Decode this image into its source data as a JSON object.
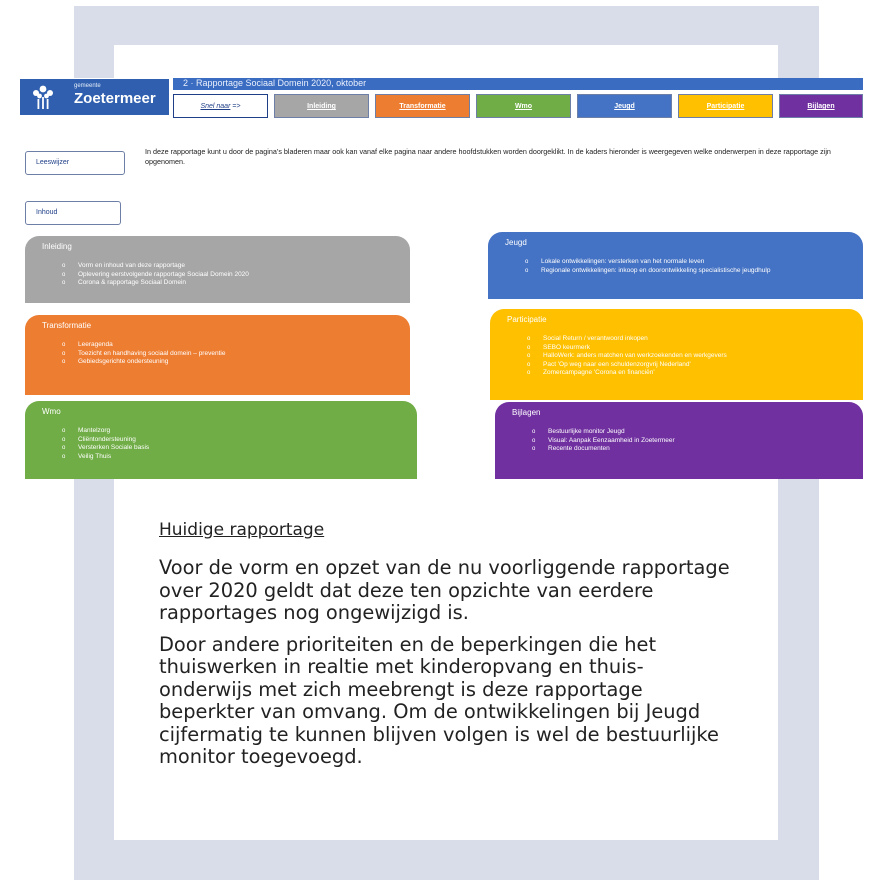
{
  "embedded_page": {
    "logo": {
      "small": "gemeente",
      "name": "Zoetermeer"
    },
    "title_bar": "2 · Rapportage Sociaal Domein 2020, oktober",
    "snel_naar": {
      "text": "Snel naar",
      "arrow": "=>"
    },
    "nav": [
      {
        "label": "Inleiding",
        "color": "#a6a6a6",
        "text_color": "#ffffff"
      },
      {
        "label": "Transformatie",
        "color": "#ed7d31",
        "text_color": "#ffffff"
      },
      {
        "label": "Wmo",
        "color": "#70ad47",
        "text_color": "#ffffff"
      },
      {
        "label": "Jeugd",
        "color": "#4472c4",
        "text_color": "#ffffff"
      },
      {
        "label": "Participatie",
        "color": "#ffc000",
        "text_color": "#ffffff"
      },
      {
        "label": "Bijlagen",
        "color": "#7030a0",
        "text_color": "#ffffff"
      }
    ],
    "leeswijzer": "Leeswijzer",
    "intro": "In deze rapportage kunt u door de pagina’s bladeren maar ook kan vanaf elke pagina naar andere hoofdstukken worden doorgeklikt. In de kaders hieronder is weergegeven welke onderwerpen in deze rapportage zijn opgenomen.",
    "inhoud": "Inhoud",
    "cards": [
      {
        "title": "Inleiding",
        "color": "#a6a6a6",
        "items": [
          "Vorm en inhoud van deze rapportage",
          "Oplevering eerstvolgende rapportage Sociaal Domein 2020",
          "Corona & rapportage Sociaal Domein"
        ]
      },
      {
        "title": "Jeugd",
        "color": "#4472c4",
        "items": [
          "Lokale ontwikkelingen: versterken van het normale leven",
          "Regionale ontwikkelingen: inkoop en doorontwikkeling specialistische jeugdhulp"
        ]
      },
      {
        "title": "Transformatie",
        "color": "#ed7d31",
        "items": [
          "Leeragenda",
          "Toezicht en handhaving sociaal domein – preventie",
          "Gebiedsgerichte ondersteuning"
        ]
      },
      {
        "title": "Participatie",
        "color": "#ffc000",
        "items": [
          "Social Return / verantwoord inkopen",
          "SEBO keurmerk",
          "HalloWerk: anders matchen van werkzoekenden en werkgevers",
          "Pact 'Op weg naar een schuldenzorgvrij Nederland'",
          "Zomercampagne 'Corona en financiën'"
        ]
      },
      {
        "title": "Wmo",
        "color": "#70ad47",
        "items": [
          "Mantelzorg",
          "Cliëntondersteuning",
          "Versterken Sociale basis",
          "Veilig Thuis"
        ]
      },
      {
        "title": "Bijlagen",
        "color": "#7030a0",
        "items": [
          "Bestuurlijke monitor Jeugd",
          "Visual: Aanpak Eenzaamheid in Zoetermeer",
          "Recente documenten"
        ]
      }
    ]
  },
  "document": {
    "heading": "Huidige rapportage",
    "paragraphs": [
      "Voor de vorm en opzet van de nu voorliggende rapportage over 2020 geldt dat deze ten opzichte van eerdere rapportages nog ongewijzigd is.",
      "Door andere prioriteiten en de beperkingen die het thuiswerken in realtie met kinderopvang en thuis-onderwijs met zich meebrengt is deze rapportage beperkter van omvang. Om de ontwikkelingen bij Jeugd cijfermatig te kunnen blijven volgen is wel de bestuurlijke monitor toegevoegd."
    ]
  }
}
